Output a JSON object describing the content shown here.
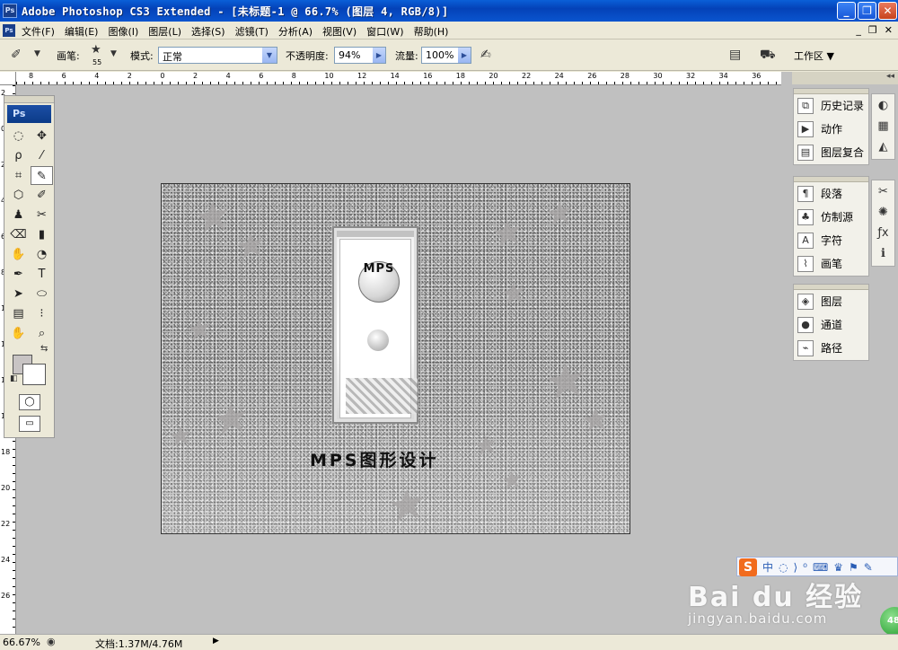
{
  "window": {
    "title": "Adobe Photoshop CS3 Extended - [未标题-1 @ 66.7% (图层 4, RGB/8)]",
    "app_icon": "Ps",
    "minimize": "_",
    "restore": "❐",
    "close": "✕"
  },
  "menu": {
    "items": [
      "文件(F)",
      "编辑(E)",
      "图像(I)",
      "图层(L)",
      "选择(S)",
      "滤镜(T)",
      "分析(A)",
      "视图(V)",
      "窗口(W)",
      "帮助(H)"
    ],
    "mdi": [
      "_",
      "❐",
      "✕"
    ]
  },
  "options": {
    "brush_label": "画笔:",
    "brush_size": "55",
    "mode_label": "模式:",
    "mode_value": "正常",
    "opacity_label": "不透明度:",
    "opacity_value": "94%",
    "flow_label": "流量:",
    "flow_value": "100%",
    "workspace_label": "工作区 ▼"
  },
  "rulers": {
    "horizontal": [
      "8",
      "6",
      "4",
      "2",
      "0",
      "2",
      "4",
      "6",
      "8",
      "10",
      "12",
      "14",
      "16",
      "18",
      "20",
      "22",
      "24",
      "26",
      "28",
      "30",
      "32",
      "34",
      "36"
    ],
    "vertical": [
      "2",
      "0",
      "2",
      "4",
      "6",
      "8",
      "10",
      "12",
      "14",
      "16",
      "18",
      "20",
      "22",
      "24",
      "26"
    ]
  },
  "canvas": {
    "badge_text": "MPS",
    "caption": "MPS图形设计"
  },
  "toolbox": {
    "logo": "Ps",
    "tools": [
      "◌",
      "✥",
      "ρ",
      "⁄",
      "⌗",
      "✎",
      "⬡",
      "✐",
      "♟",
      "✂",
      "⌫",
      "▮",
      "✋",
      "◔",
      "✒",
      "T",
      "➤",
      "⬭",
      "▤",
      "⁝",
      "✋",
      "⌕"
    ],
    "mode_buttons": [
      "◯",
      "▭"
    ]
  },
  "panels": {
    "group1": [
      "历史记录",
      "动作",
      "图层复合"
    ],
    "group2": [
      "段落",
      "仿制源",
      "字符",
      "画笔"
    ],
    "group3": [
      "图层",
      "通道",
      "路径"
    ],
    "group1_icons": [
      "⧉",
      "▶",
      "▤"
    ],
    "group2_icons": [
      "¶",
      "♣",
      "A",
      "⌇"
    ],
    "group3_icons": [
      "◈",
      "●",
      "⌁"
    ],
    "side_icons_1": [
      "◐",
      "▦",
      "◭"
    ],
    "side_icons_2": [
      "✂",
      "✺",
      "ƒx",
      "ℹ"
    ],
    "collapse": "◂◂"
  },
  "status": {
    "zoom": "66.67%",
    "doc": "文档:1.37M/4.76M",
    "arrow": "▶"
  },
  "tray": {
    "logo": "S",
    "icons": "中◌⟩⁰⌨♛⚑✎",
    "watermark": "Bai du 经验",
    "watermark_url": "jingyan.baidu.com",
    "orb": "48"
  }
}
